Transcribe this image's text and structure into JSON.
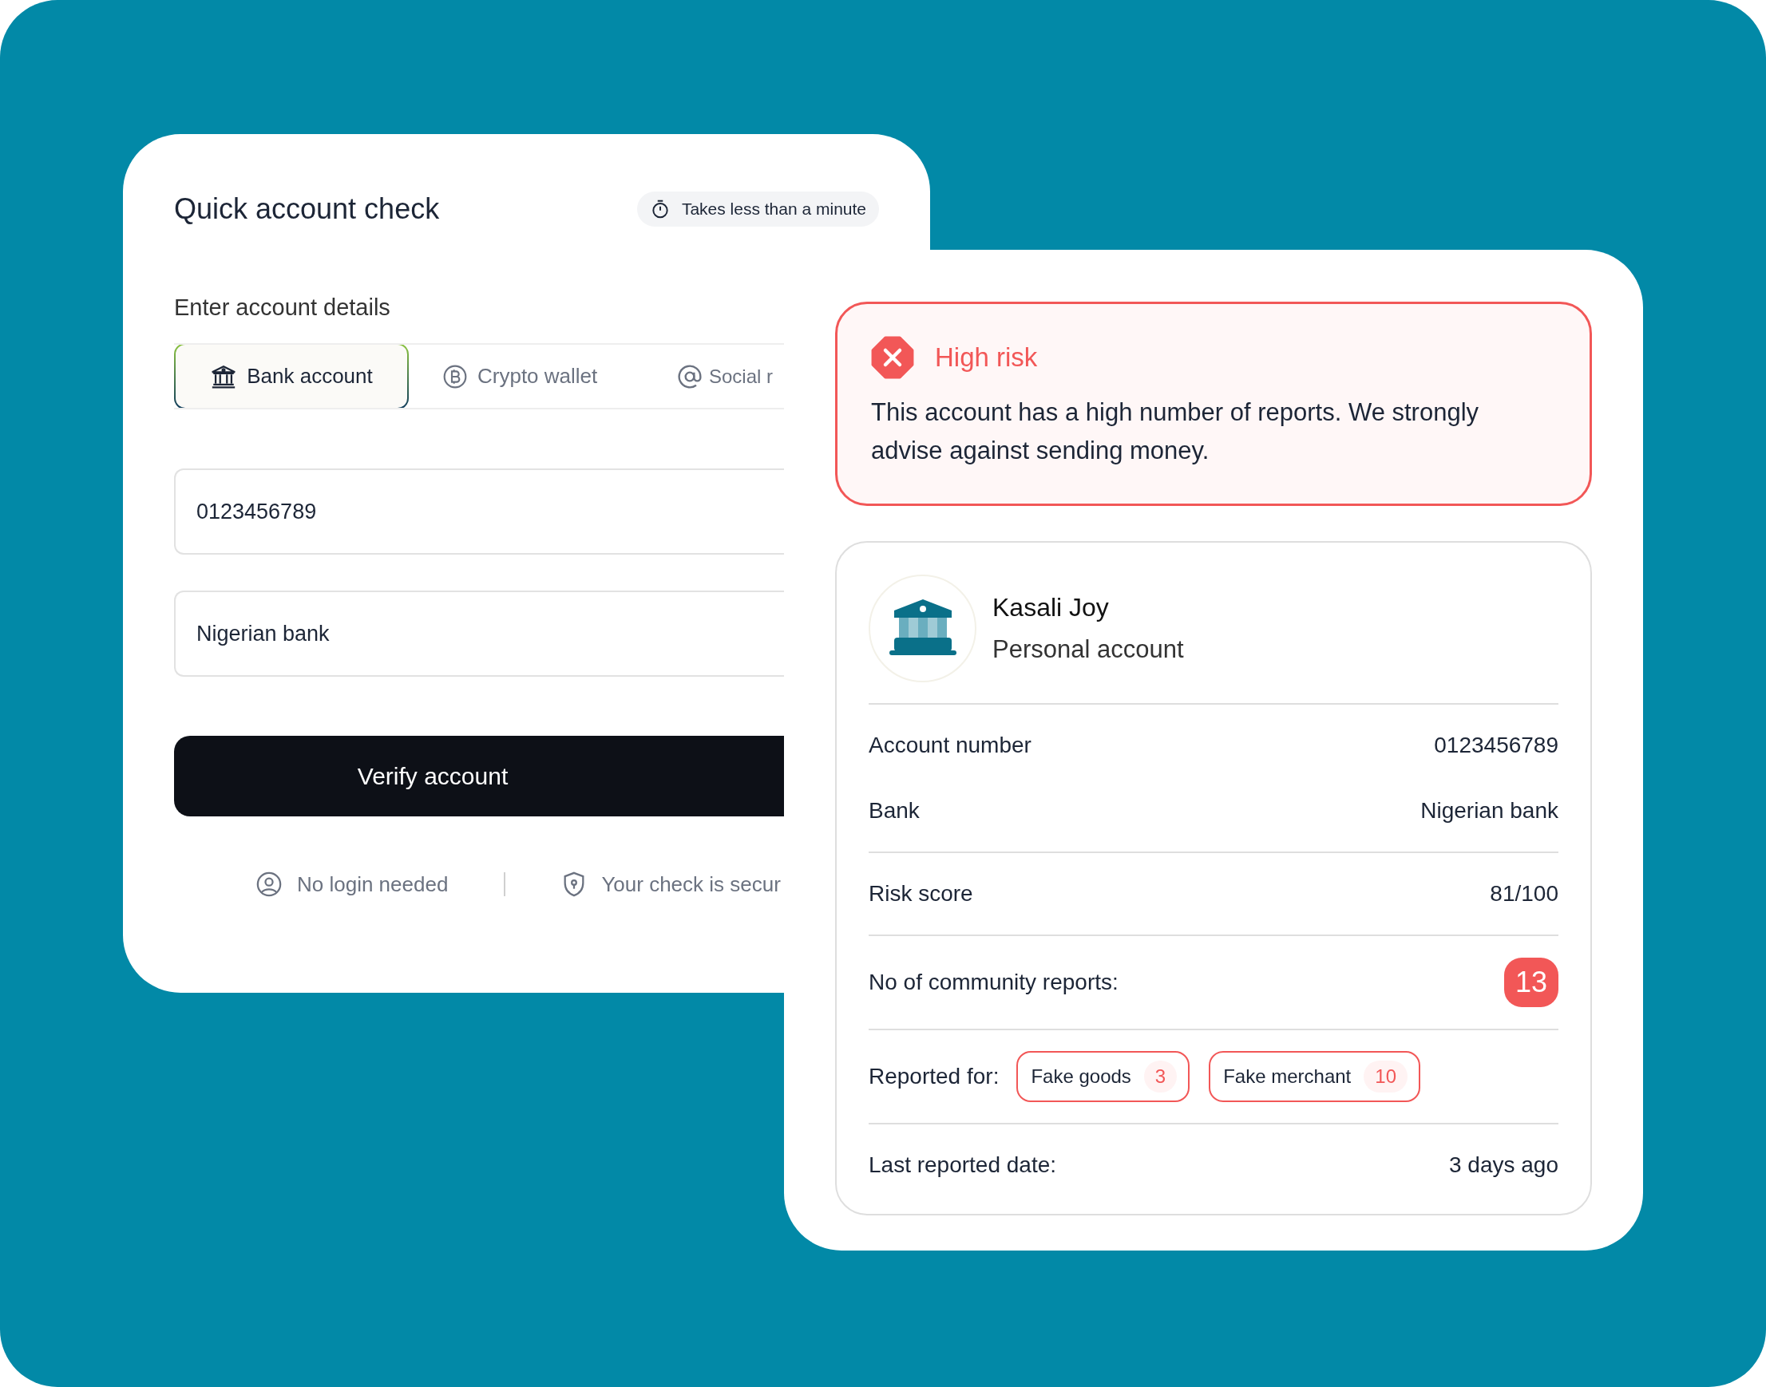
{
  "quick_check": {
    "title": "Quick account check",
    "badge": "Takes less than a minute",
    "section_label": "Enter account details",
    "tabs": [
      {
        "label": "Bank account",
        "kind": "bank",
        "selected": true
      },
      {
        "label": "Crypto wallet",
        "kind": "crypto",
        "selected": false
      },
      {
        "label": "Social r",
        "kind": "social",
        "selected": false
      }
    ],
    "fields": [
      {
        "value": "0123456789"
      },
      {
        "value": "Nigerian bank"
      }
    ],
    "button": "Verify account",
    "notes": [
      {
        "label": "No login needed",
        "kind": "user"
      },
      {
        "label": "Your check is secur",
        "kind": "shield"
      }
    ]
  },
  "result": {
    "alert": {
      "title": "High risk",
      "message": "This account has a high number of reports. We strongly advise against sending money."
    },
    "account": {
      "name": "Kasali Joy",
      "type": "Personal account"
    },
    "sections": [
      {
        "rows": [
          {
            "kind": "text",
            "label": "Account number",
            "value": "0123456789"
          },
          {
            "kind": "text",
            "label": "Bank",
            "value": "Nigerian bank"
          }
        ]
      },
      {
        "rows": [
          {
            "kind": "text",
            "label": "Risk score",
            "value": "81/100"
          }
        ]
      },
      {
        "rows": [
          {
            "kind": "count",
            "label": "No of community reports:",
            "value": "13"
          }
        ]
      },
      {
        "rows": [
          {
            "kind": "tags",
            "label": "Reported for:",
            "tags": [
              {
                "label": "Fake goods",
                "count": "3"
              },
              {
                "label": "Fake merchant",
                "count": "10"
              }
            ]
          }
        ]
      },
      {
        "rows": [
          {
            "kind": "text",
            "label": "Last reported date:",
            "value": "3 days ago"
          }
        ]
      }
    ]
  }
}
